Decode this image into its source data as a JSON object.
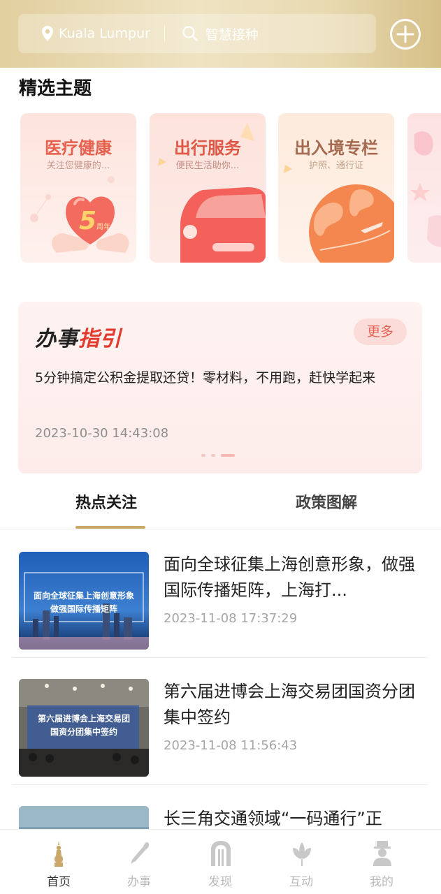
{
  "header": {
    "location": "Kuala Lumpur",
    "search_placeholder": "智慧接种",
    "add_icon": "plus-circle-icon",
    "gradient_colors": [
      "#e2cf9f",
      "#efe3c2",
      "#d6bf87"
    ]
  },
  "featured": {
    "title": "精选主题",
    "cards": [
      {
        "title": "医疗健康",
        "subtitle": "关注您健康的...",
        "badge": "5",
        "badge_caption": "周年"
      },
      {
        "title": "出行服务",
        "subtitle": "便民生活助你..."
      },
      {
        "title": "出入境专栏",
        "subtitle": "护照、通行证"
      },
      {
        "title": "",
        "subtitle": ""
      }
    ]
  },
  "guide": {
    "logo_part1": "办事",
    "logo_part2": "指引",
    "more_label": "更多",
    "headline": "5分钟搞定公积金提取还贷！零材料，不用跑，赶快学起来",
    "date": "2023-10-30 14:43:08",
    "accent_color": "#e23b2d"
  },
  "tabs": [
    {
      "label": "热点关注",
      "active": true
    },
    {
      "label": "政策图解",
      "active": false
    }
  ],
  "news": [
    {
      "title": "面向全球征集上海创意形象，做强国际传播矩阵，上海打...",
      "date": "2023-11-08 17:37:29",
      "thumb_caption_1": "面向全球征集上海创意形象",
      "thumb_caption_2": "做强国际传播矩阵"
    },
    {
      "title": "第六届进博会上海交易团国资分团集中签约",
      "date": "2023-11-08 11:56:43",
      "thumb_caption_1": "第六届进博会上海交易团",
      "thumb_caption_2": "国资分团集中签约"
    },
    {
      "title": "长三角交通领域“一码通行”正",
      "date": ""
    }
  ],
  "bottom_nav": [
    {
      "label": "首页",
      "icon": "home-tower-icon",
      "active": true
    },
    {
      "label": "办事",
      "icon": "pen-icon",
      "active": false
    },
    {
      "label": "发现",
      "icon": "arch-icon",
      "active": false
    },
    {
      "label": "互动",
      "icon": "lotus-icon",
      "active": false
    },
    {
      "label": "我的",
      "icon": "person-icon",
      "active": false
    }
  ]
}
